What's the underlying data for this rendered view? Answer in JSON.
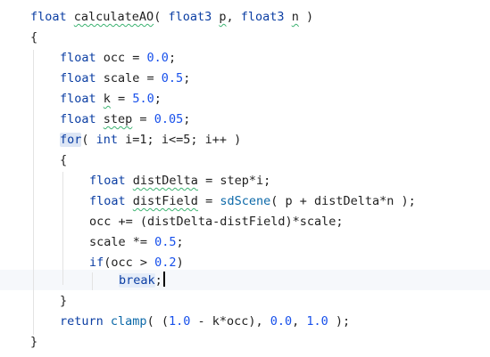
{
  "code": {
    "l1": {
      "type": "float",
      "name": "calculateAO",
      "open": "( ",
      "t1": "float3",
      "p": "p",
      "sep": ", ",
      "t2": "float3",
      "n": "n",
      "close": " )"
    },
    "l2": {
      "text": "{"
    },
    "l3": {
      "kw": "float",
      "rest": " occ = ",
      "num": "0.0",
      "end": ";"
    },
    "l4": {
      "kw": "float",
      "rest": " scale = ",
      "num": "0.5",
      "end": ";"
    },
    "l5": {
      "kw": "float",
      "var": "k",
      "eq": " = ",
      "num": "5.0",
      "end": ";"
    },
    "l6": {
      "kw": "float",
      "var": "step",
      "eq": " = ",
      "num": "0.05",
      "end": ";"
    },
    "l7": {
      "kw": "for",
      "p1": "( ",
      "kw2": "int",
      "rest": " i=1; i<=5; i++ )"
    },
    "l8": {
      "text": "{"
    },
    "l9": {
      "kw": "float",
      "var": "distDelta",
      "rest": " = step*i;"
    },
    "l10": {
      "kw": "float",
      "var": "distField",
      "eq": " = ",
      "fn": "sdScene",
      "rest": "( p + distDelta*n );"
    },
    "l11": {
      "text": "occ += (distDelta-distField)*scale;"
    },
    "l12": {
      "pre": "scale *= ",
      "num": "0.5",
      "end": ";"
    },
    "l13": {
      "kw": "if",
      "pre": "(occ > ",
      "num": "0.2",
      "end": ")"
    },
    "l14": {
      "kw": "break",
      "end": ";"
    },
    "l15": {
      "text": "}"
    },
    "l16": {
      "kw": "return",
      "sp": " ",
      "fn": "clamp",
      "p1": "( (",
      "n1": "1.0",
      "mid": " - k*occ), ",
      "n2": "0.0",
      "c": ", ",
      "n3": "1.0",
      "end": " );"
    },
    "l17": {
      "text": "}"
    }
  }
}
